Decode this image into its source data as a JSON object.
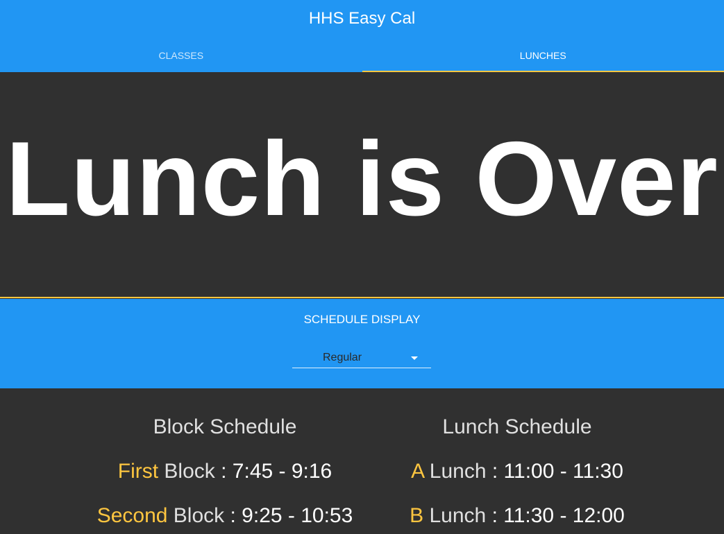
{
  "app": {
    "title": "HHS Easy Cal"
  },
  "tabs": [
    {
      "label": "CLASSES",
      "active": false
    },
    {
      "label": "LUNCHES",
      "active": true
    }
  ],
  "hero": {
    "message": "Lunch is Over"
  },
  "schedule_display": {
    "label": "SCHEDULE DISPLAY",
    "selected": "Regular"
  },
  "block_schedule": {
    "title": "Block Schedule",
    "items": [
      {
        "name": "First",
        "suffix": "Block",
        "time": ": 7:45 - 9:16"
      },
      {
        "name": "Second",
        "suffix": "Block",
        "time": ": 9:25 - 10:53"
      }
    ]
  },
  "lunch_schedule": {
    "title": "Lunch Schedule",
    "items": [
      {
        "name": "A",
        "suffix": "Lunch",
        "time": ": 11:00 - 11:30"
      },
      {
        "name": "B",
        "suffix": "Lunch",
        "time": ": 11:30 - 12:00"
      }
    ]
  },
  "colors": {
    "primary": "#2196f3",
    "accent": "#ffc640",
    "background": "#303030",
    "text": "#ffffff"
  }
}
